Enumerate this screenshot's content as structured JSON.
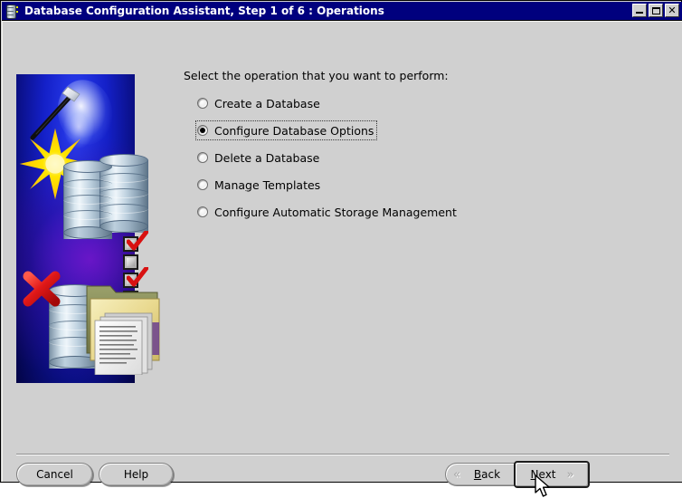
{
  "window": {
    "title": "Database Configuration Assistant, Step 1 of 6 : Operations",
    "icon": "database-wizard-icon",
    "controls": {
      "minimize": "_",
      "maximize": "□",
      "close": "✕"
    }
  },
  "main": {
    "prompt": "Select the operation that you want to perform:",
    "options": [
      {
        "label": "Create a Database",
        "mnemonic": "",
        "selected": false,
        "focused": false
      },
      {
        "label": "Configure Database Options",
        "mnemonic": "g",
        "selected": true,
        "focused": true
      },
      {
        "label": "Delete a Database",
        "mnemonic": "",
        "selected": false,
        "focused": false
      },
      {
        "label": "Manage Templates",
        "mnemonic": "g",
        "selected": false,
        "focused": false
      },
      {
        "label": "Configure Automatic Storage Management",
        "mnemonic": "",
        "selected": false,
        "focused": false
      }
    ]
  },
  "graphic": {
    "description": "oracle-dbca-splash-graphic",
    "elements": [
      "magic-wand-icon",
      "starburst-icon",
      "database-cylinder-icon",
      "checklist-icon",
      "red-x-icon",
      "folder-documents-icon"
    ],
    "background_color": "#0a0d7a",
    "accent_color": "#2a3ef0"
  },
  "footer": {
    "cancel_label": "Cancel",
    "help_label": "Help",
    "back_label": "Back",
    "back_mnemonic": "B",
    "next_label": "Next",
    "next_mnemonic": "N",
    "back_chevron": "«",
    "next_chevron": "»"
  },
  "colors": {
    "titlebar": "#00007e",
    "face": "#d0d0d0",
    "text": "#000000",
    "check_red": "#d81111"
  }
}
